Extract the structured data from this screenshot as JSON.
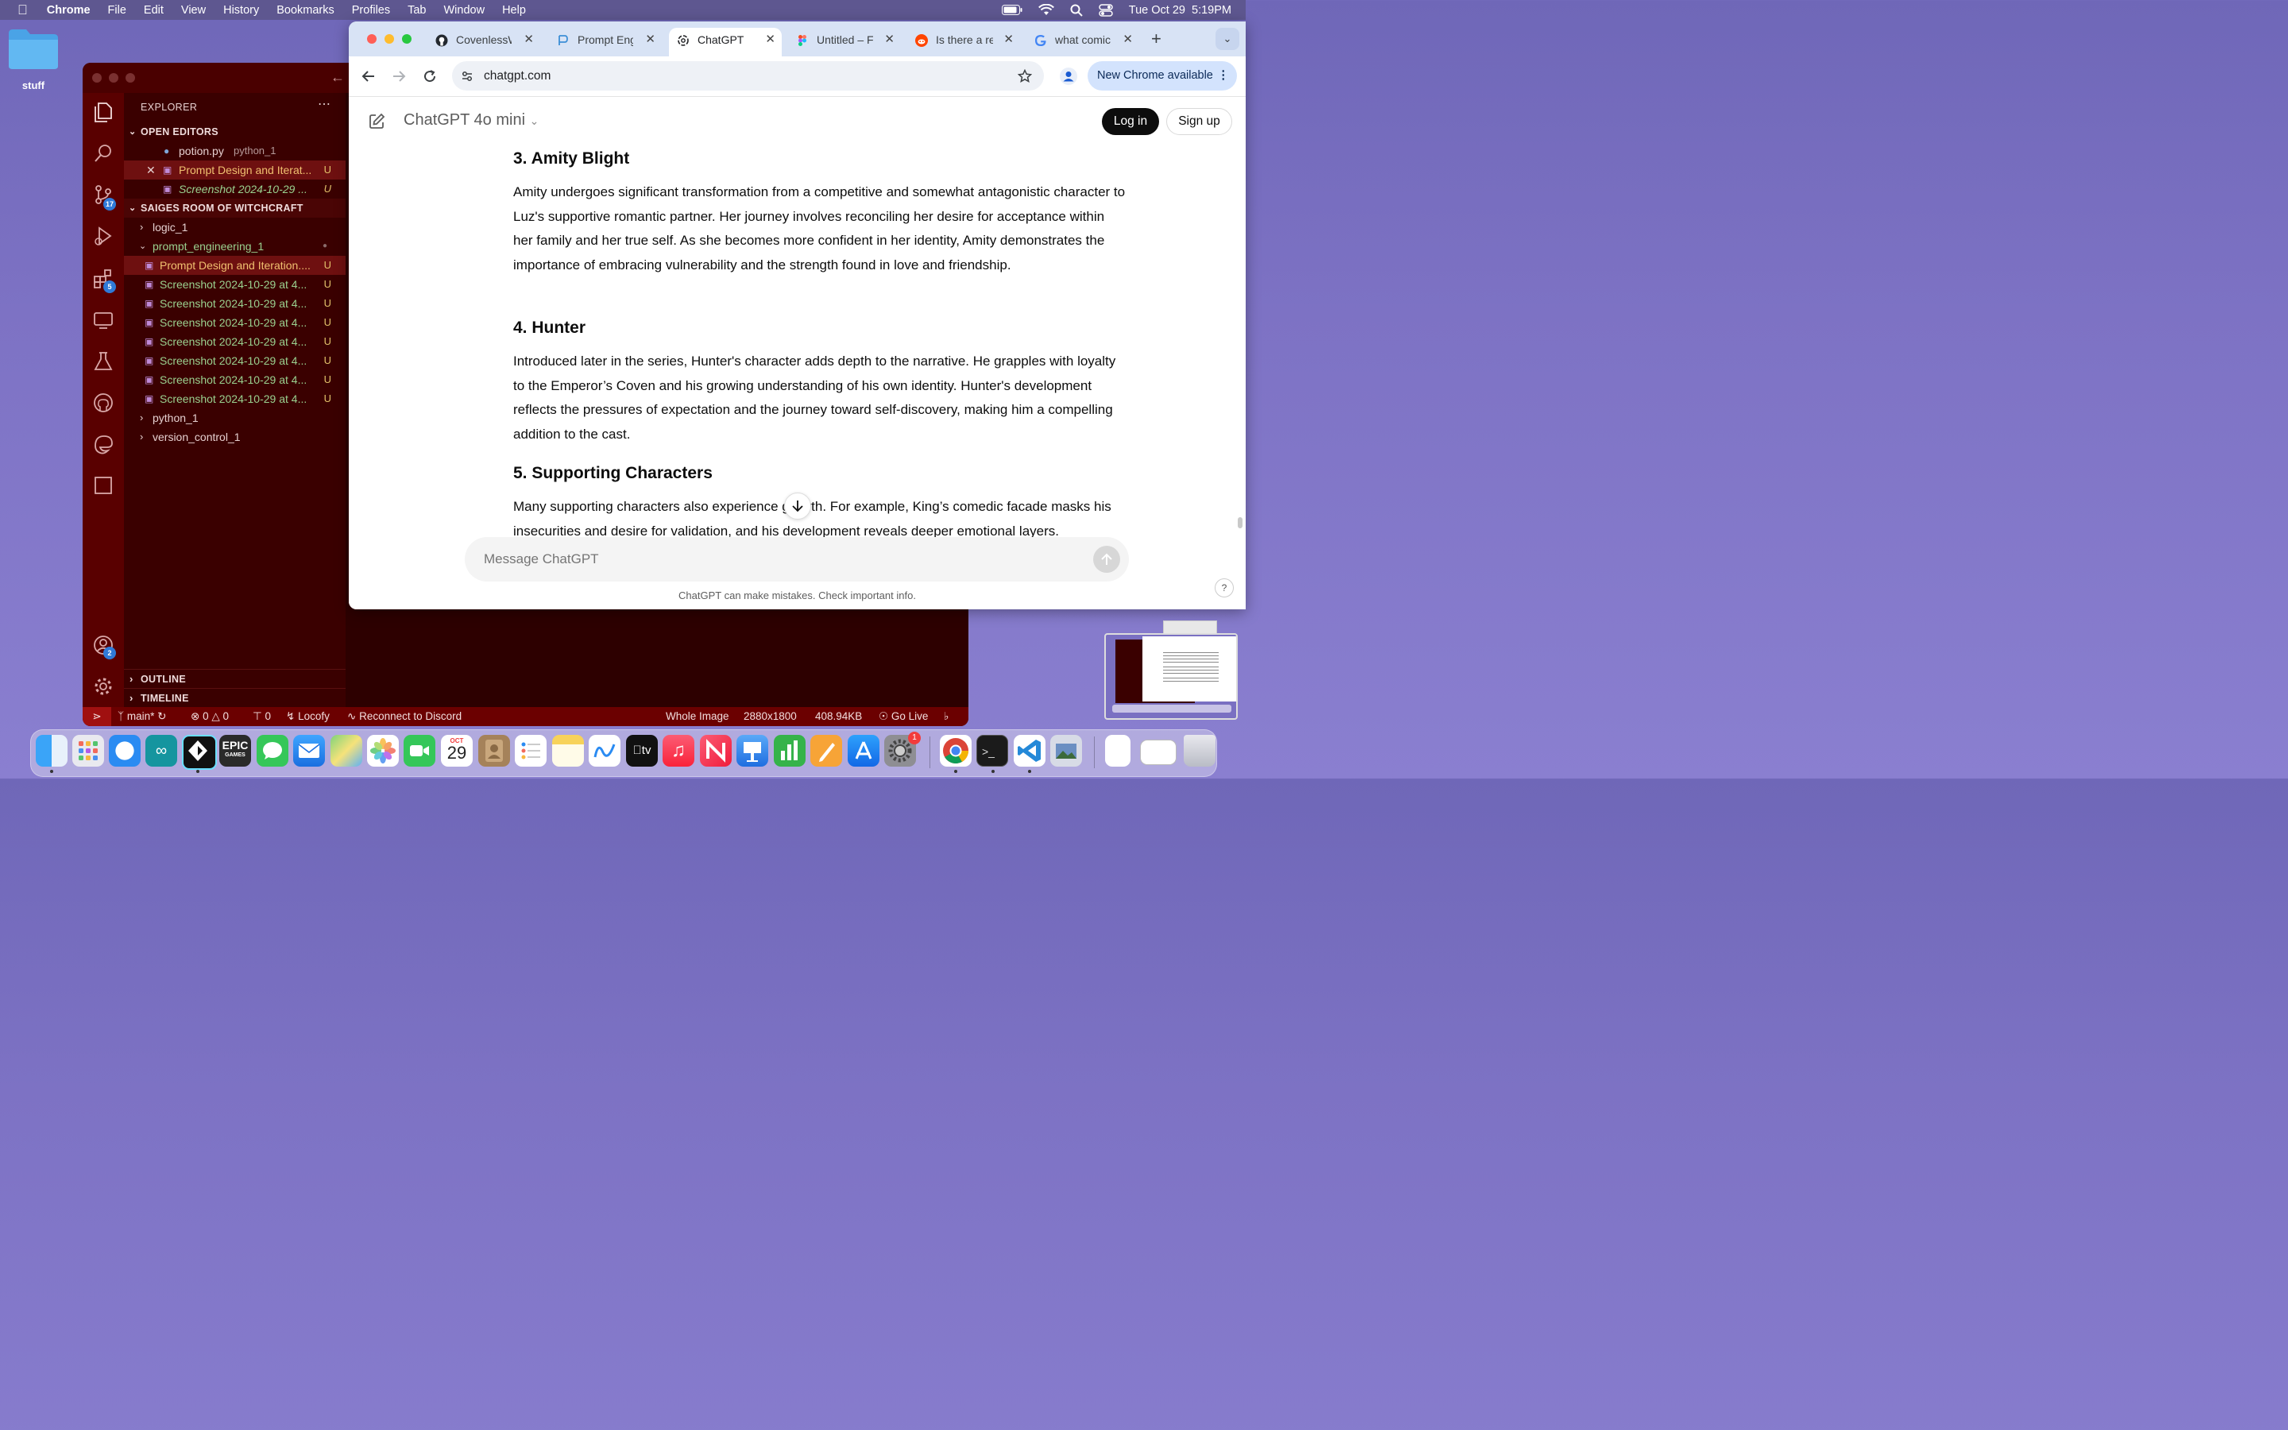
{
  "menubar": {
    "app": "Chrome",
    "items": [
      "File",
      "Edit",
      "View",
      "History",
      "Bookmarks",
      "Profiles",
      "Tab",
      "Window",
      "Help"
    ],
    "clock": "Tue Oct 29  5:19PM"
  },
  "desktop": {
    "folder_label": "stuff"
  },
  "vscode": {
    "explorer_title": "EXPLORER",
    "open_editors_label": "OPEN EDITORS",
    "open_editors": [
      {
        "name": "potion.py",
        "detail": "python_1"
      },
      {
        "name": "Prompt Design and Iterat...",
        "status": "U"
      },
      {
        "name": "Screenshot 2024-10-29 ...",
        "status": "U"
      }
    ],
    "workspace_label": "SAIGES ROOM OF WITCHCRAFT",
    "folders": {
      "logic": "logic_1",
      "prompt": "prompt_engineering_1",
      "python": "python_1",
      "version": "version_control_1"
    },
    "prompt_files": [
      {
        "name": "Prompt Design and Iteration....",
        "status": "U"
      },
      {
        "name": "Screenshot 2024-10-29 at 4...",
        "status": "U"
      },
      {
        "name": "Screenshot 2024-10-29 at 4...",
        "status": "U"
      },
      {
        "name": "Screenshot 2024-10-29 at 4...",
        "status": "U"
      },
      {
        "name": "Screenshot 2024-10-29 at 4...",
        "status": "U"
      },
      {
        "name": "Screenshot 2024-10-29 at 4...",
        "status": "U"
      },
      {
        "name": "Screenshot 2024-10-29 at 4...",
        "status": "U"
      },
      {
        "name": "Screenshot 2024-10-29 at 4...",
        "status": "U"
      }
    ],
    "outline_label": "OUTLINE",
    "timeline_label": "TIMELINE",
    "badges": {
      "source_control": "17",
      "extensions": "5",
      "accounts": "2"
    },
    "status": {
      "branch": "main*",
      "errors": "0",
      "warnings": "0",
      "ports": "0",
      "locofy": "Locofy",
      "discord": "Reconnect to Discord",
      "image_mode": "Whole Image",
      "dimensions": "2880x1800",
      "filesize": "408.94KB",
      "golive": "Go Live"
    }
  },
  "chrome": {
    "tabs": [
      {
        "title": "CovenlessW",
        "icon": "github-icon"
      },
      {
        "title": "Prompt Eng",
        "icon": "perplexity-icon"
      },
      {
        "title": "ChatGPT",
        "icon": "openai-icon",
        "active": true
      },
      {
        "title": "Untitled – F",
        "icon": "figma-icon"
      },
      {
        "title": "Is there a re",
        "icon": "reddit-icon"
      },
      {
        "title": "what comic",
        "icon": "google-icon"
      }
    ],
    "url": "chatgpt.com",
    "update_button": "New Chrome available"
  },
  "chatgpt": {
    "model": "ChatGPT 4o mini",
    "login": "Log in",
    "signup": "Sign up",
    "sections": [
      {
        "heading": "3. Amity Blight",
        "text": "Amity undergoes significant transformation from a competitive and somewhat antagonistic character to Luz's supportive romantic partner. Her journey involves reconciling her desire for acceptance within her family and her true self. As she becomes more confident in her identity, Amity demonstrates the importance of embracing vulnerability and the strength found in love and friendship."
      },
      {
        "heading": "4. Hunter",
        "text": "Introduced later in the series, Hunter's character adds depth to the narrative. He grapples with loyalty to the Emperor’s Coven and his growing understanding of his own identity. Hunter's development reflects the pressures of expectation and the journey toward self-discovery, making him a compelling addition to the cast."
      },
      {
        "heading": "5. Supporting Characters",
        "text": "Many supporting characters also experience growth. For example, King’s comedic facade masks his insecurities and desire for validation, and his development reveals deeper emotional layers."
      }
    ],
    "placeholder": "Message ChatGPT",
    "disclaimer": "ChatGPT can make mistakes. Check important info.",
    "help": "?"
  },
  "dock": {
    "calendar_month": "OCT",
    "calendar_day": "29",
    "epic_label": "EPIC",
    "epic_sub": "GAMES",
    "tv_label": "tv",
    "settings_badge": "1"
  }
}
